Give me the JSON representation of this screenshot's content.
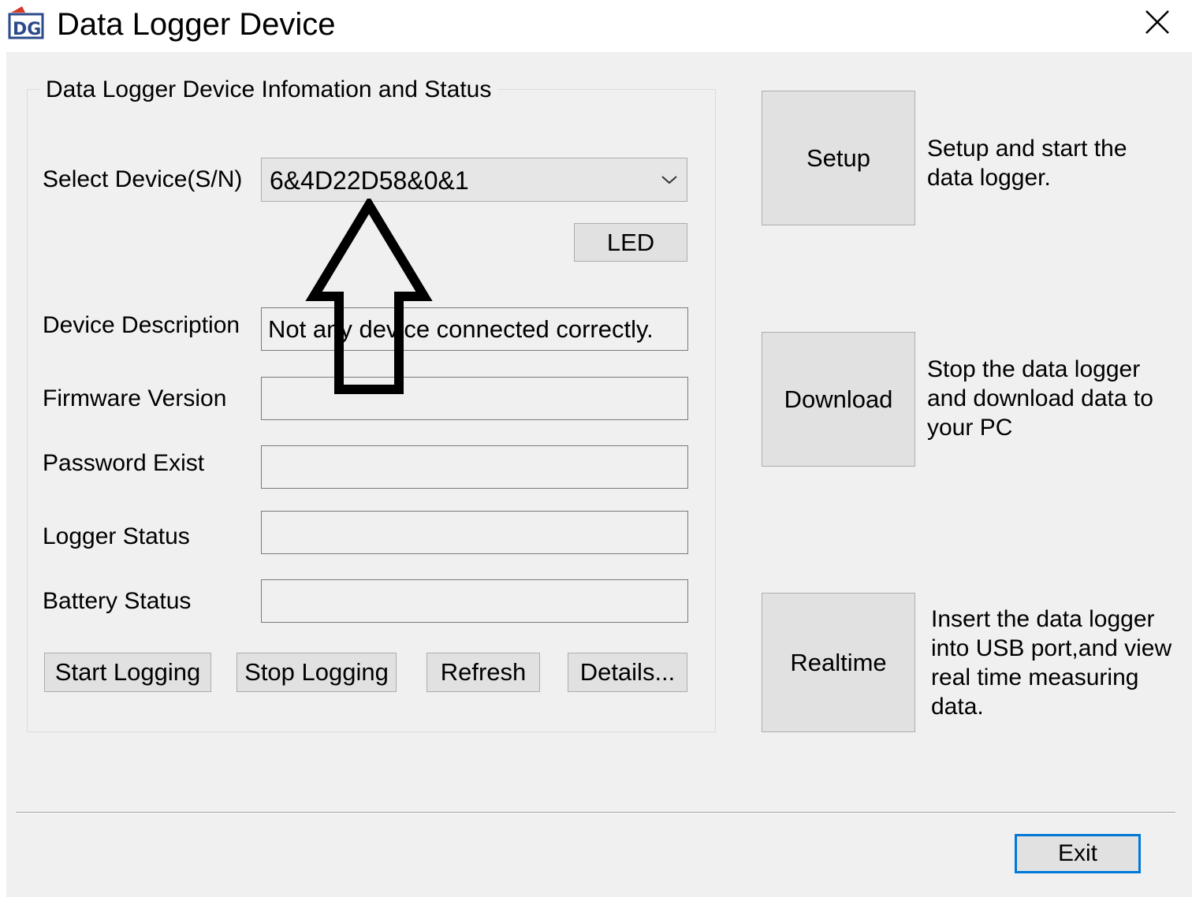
{
  "window": {
    "title": "Data Logger Device",
    "icon": "dg-app-icon",
    "close_icon": "close-x-icon"
  },
  "group": {
    "legend": "Data Logger Device Infomation and Status"
  },
  "device_select": {
    "label": "Select Device(S/N)",
    "value": "6&4D22D58&0&1",
    "dropdown_icon": "chevron-down-icon"
  },
  "led_button": "LED",
  "fields": {
    "device_description": {
      "label": "Device Description",
      "value": "Not any device connected correctly."
    },
    "firmware_version": {
      "label": "Firmware Version",
      "value": ""
    },
    "password_exist": {
      "label": "Password Exist",
      "value": ""
    },
    "logger_status": {
      "label": "Logger Status",
      "value": ""
    },
    "battery_status": {
      "label": "Battery Status",
      "value": ""
    }
  },
  "action_buttons": {
    "start_logging": "Start Logging",
    "stop_logging": "Stop Logging",
    "refresh": "Refresh",
    "details": "Details..."
  },
  "side_actions": {
    "setup": {
      "label": "Setup",
      "desc": [
        "Setup and start the",
        "data logger."
      ]
    },
    "download": {
      "label": "Download",
      "desc": [
        "Stop the data logger",
        "and download data to",
        "your PC"
      ]
    },
    "realtime": {
      "label": "Realtime",
      "desc": [
        "Insert the data logger",
        "into USB port,and view",
        "real time measuring",
        "data."
      ]
    }
  },
  "exit_button": "Exit",
  "annotation": {
    "icon": "up-arrow-icon"
  }
}
